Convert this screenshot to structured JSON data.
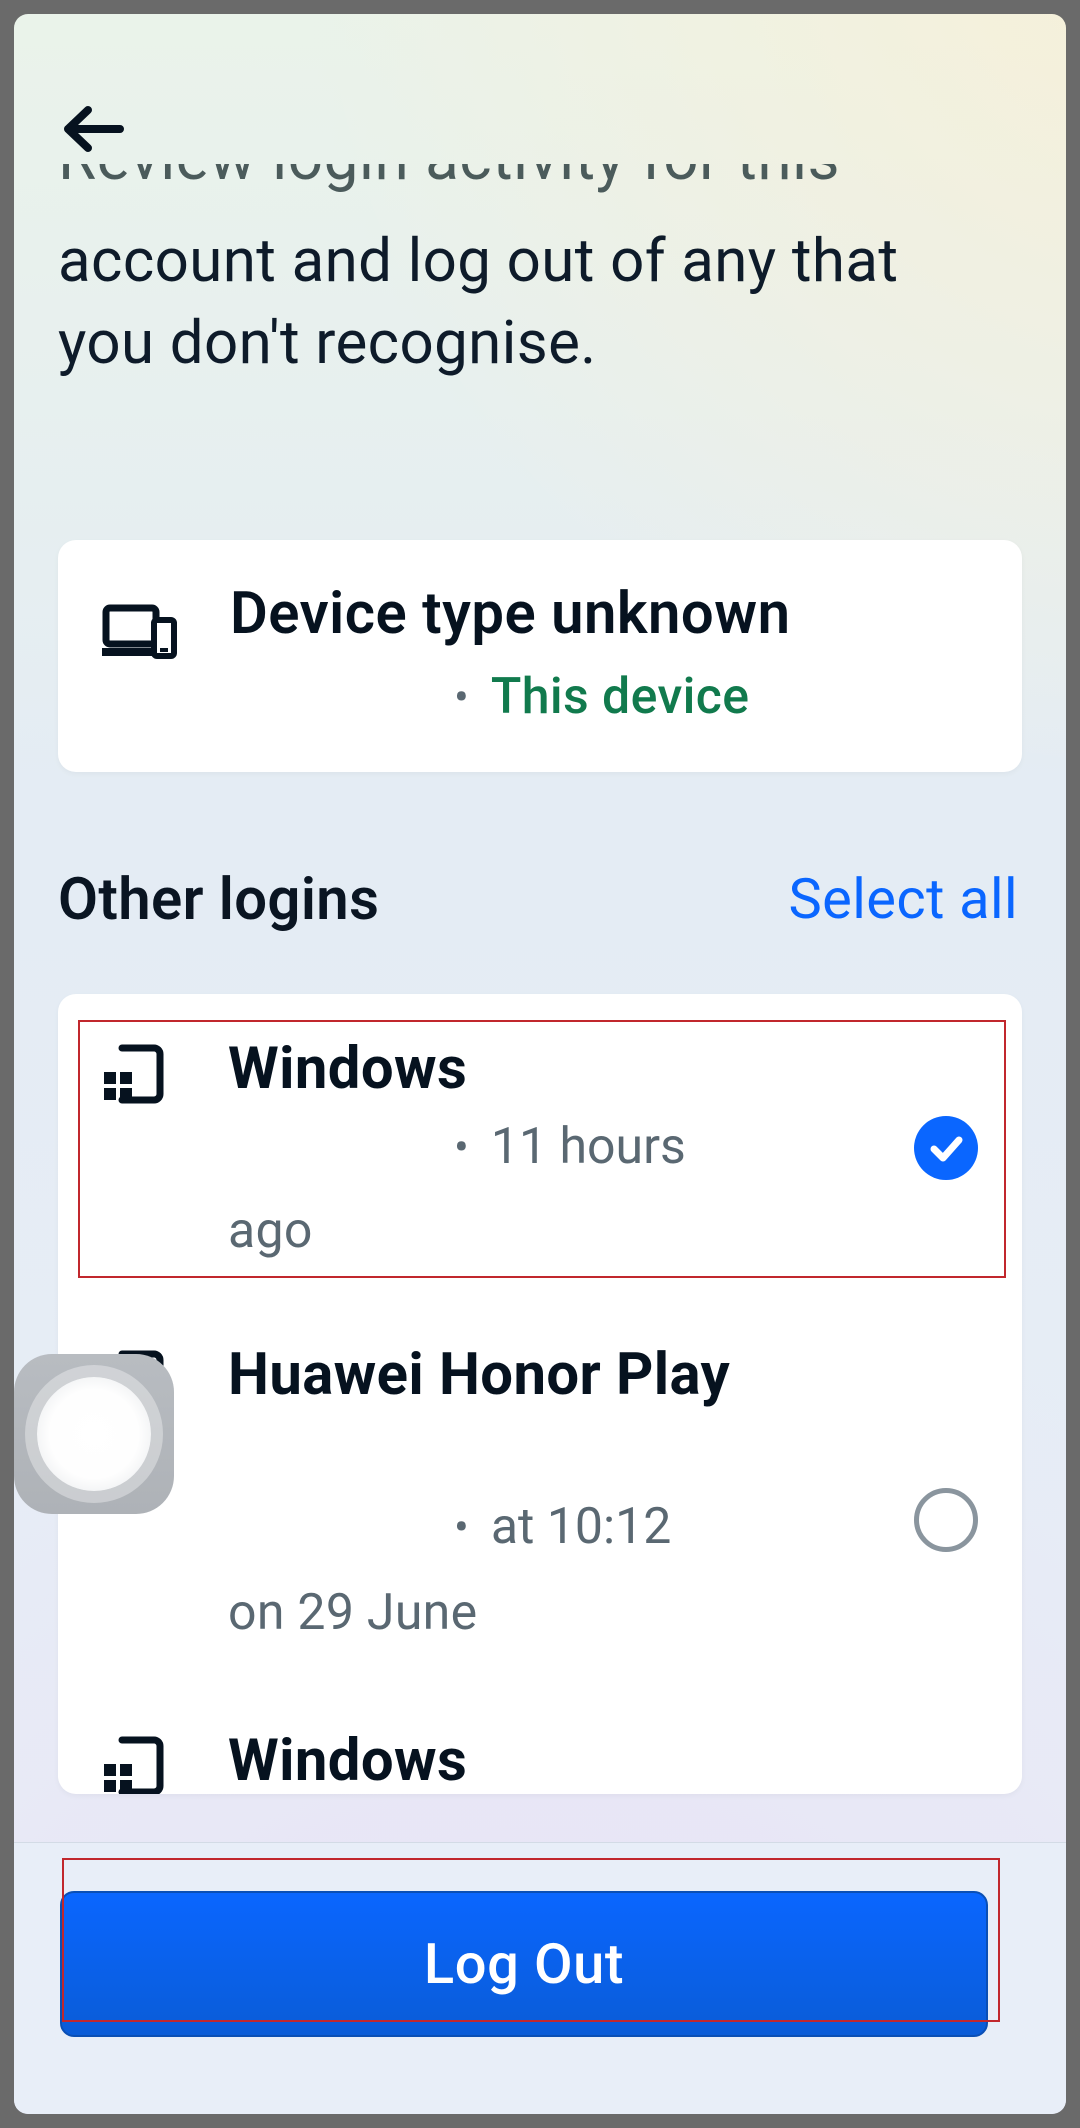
{
  "header": {
    "cut_title": "Review login activity for this"
  },
  "description": "account and log out of any that you don't recognise.",
  "current_device": {
    "title": "Device type unknown",
    "badge": "This device"
  },
  "section_title": "Other logins",
  "select_all_label": "Select all",
  "logins": [
    {
      "title": "Windows",
      "meta_right": "11 hours",
      "meta_below": "ago",
      "selected": true
    },
    {
      "title": "Huawei Honor Play",
      "meta_right": "at 10:12",
      "meta_below": "on 29 June",
      "selected": false
    },
    {
      "title": "Windows",
      "meta_right": "",
      "meta_below": "",
      "selected": false
    }
  ],
  "logout_label": "Log Out"
}
